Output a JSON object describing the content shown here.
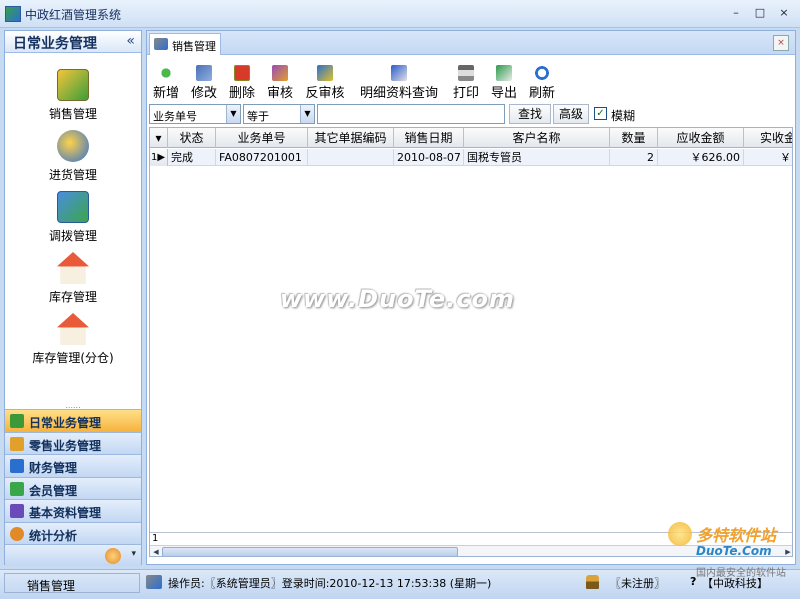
{
  "window": {
    "title": "中政红酒管理系统",
    "controls": [
      "–",
      "□",
      "×"
    ]
  },
  "nav": {
    "header": "日常业务管理",
    "collapse_glyph": "«",
    "items": [
      {
        "label": "销售管理",
        "icon": "sales-icon"
      },
      {
        "label": "进货管理",
        "icon": "purchase-icon"
      },
      {
        "label": "调拨管理",
        "icon": "transfer-icon"
      },
      {
        "label": "库存管理",
        "icon": "stock-icon"
      },
      {
        "label": "库存管理(分仓)",
        "icon": "stock-branch-icon"
      }
    ],
    "splitter": "......",
    "groups": [
      {
        "label": "日常业务管理",
        "active": true,
        "color": "#3a9a3a"
      },
      {
        "label": "零售业务管理",
        "active": false,
        "color": "#e0a02a"
      },
      {
        "label": "财务管理",
        "active": false,
        "color": "#2a6fd0"
      },
      {
        "label": "会员管理",
        "active": false,
        "color": "#3aa64a"
      },
      {
        "label": "基本资料管理",
        "active": false,
        "color": "#6a4ab8"
      },
      {
        "label": "统计分析",
        "active": false,
        "color": "#e08a2a"
      }
    ],
    "bottom_arrow": "▾"
  },
  "tab": {
    "label": "销售管理",
    "close_glyph": "×"
  },
  "toolbar": {
    "buttons": [
      {
        "label": "新增",
        "icon": "add-icon"
      },
      {
        "label": "修改",
        "icon": "edit-icon"
      },
      {
        "label": "删除",
        "icon": "delete-icon"
      },
      {
        "label": "审核",
        "icon": "audit-icon"
      },
      {
        "label": "反审核",
        "icon": "unaudit-icon"
      },
      {
        "label": "明细资料查询",
        "icon": "detail-query-icon"
      },
      {
        "label": "打印",
        "icon": "print-icon"
      },
      {
        "label": "导出",
        "icon": "export-icon"
      },
      {
        "label": "刷新",
        "icon": "refresh-icon"
      }
    ]
  },
  "filter": {
    "field_value": "业务单号",
    "operator_value": "等于",
    "search_value": "",
    "search_button": "查找",
    "advanced_button": "高级",
    "fuzzy_label": "模糊",
    "fuzzy_checked": true
  },
  "grid": {
    "columns": [
      "状态",
      "业务单号",
      "其它单据编码",
      "销售日期",
      "客户名称",
      "数量",
      "应收金额",
      "实收金额"
    ],
    "rows": [
      {
        "index": "1",
        "status": "完成",
        "order_no": "FA0807201001",
        "other_code": "",
        "date": "2010-08-07",
        "customer": "国税专管员",
        "qty": "2",
        "receivable": "￥626.00",
        "received": "￥"
      }
    ],
    "footer_count": "1"
  },
  "watermark": "www.DuoTe.com",
  "status": {
    "module": "销售管理",
    "info": "操作员:〖系统管理员〗登录时间:2010-12-13  17:53:38 (星期一)",
    "registration": "〖未注册〗",
    "help": "?",
    "company": "【中政科技】"
  },
  "logo_watermark": {
    "line1": "多特软件站",
    "line2": "DuoTe.Com",
    "line3": "国内最安全的软件站"
  }
}
